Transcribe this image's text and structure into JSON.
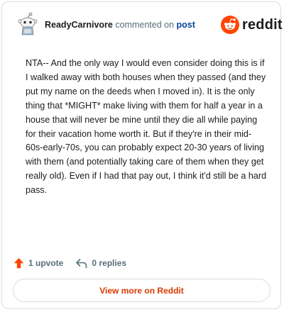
{
  "header": {
    "username": "ReadyCarnivore",
    "action_text": "commented on",
    "post_link_text": "post",
    "logo_text": "reddit",
    "avatar_icon": "snoo-avatar-icon",
    "logo_icon": "reddit-snoo-icon",
    "brand_color": "#ff4500"
  },
  "comment": {
    "text": "NTA-- And the only way I would even consider doing this is if I walked away with both houses when they passed (and they put my name on the deeds when I moved in). It is the only thing that *MIGHT* make living with them for half a year in a house that will never be mine until they die all while paying for their vacation home worth it. But if they're in their mid-60s-early-70s, you can probably expect 20-30 years of living with them (and potentially taking care of them when they get really old). Even if I had that pay out, I think it'd still be a hard pass."
  },
  "actions": {
    "upvote_label": "1 upvote",
    "upvote_icon": "upvote-arrow-icon",
    "replies_label": "0 replies",
    "reply_icon": "reply-arrow-icon"
  },
  "footer": {
    "view_more_label": "View more on Reddit"
  }
}
